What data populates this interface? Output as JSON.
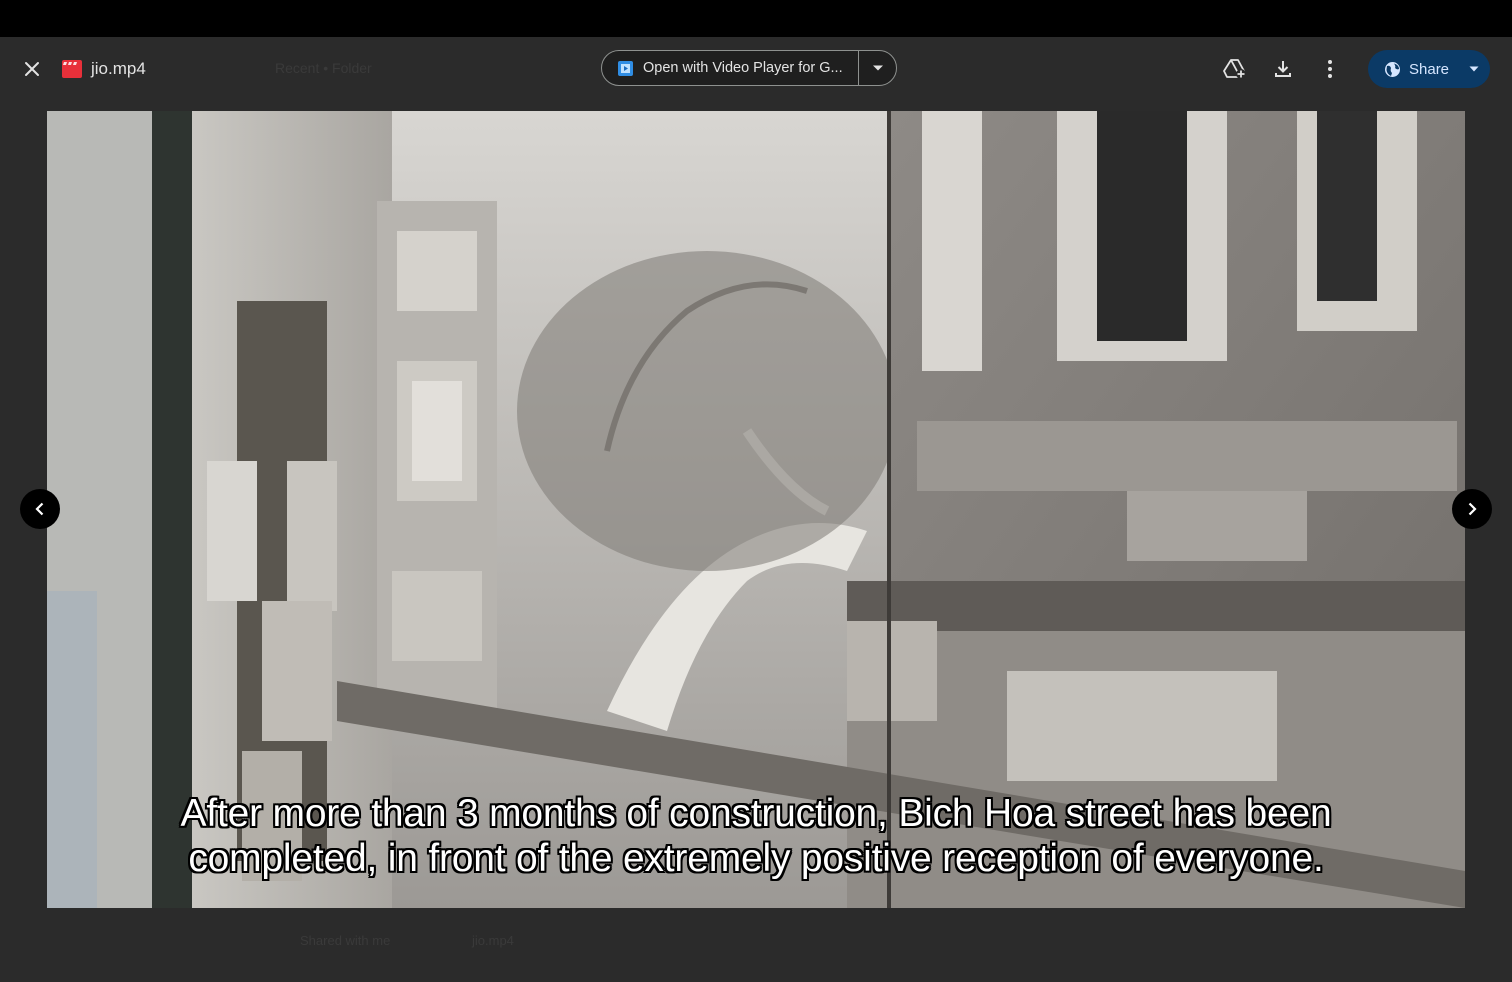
{
  "header": {
    "file_name": "jio.mp4",
    "open_with_label": "Open with Video Player for G...",
    "share_label": "Share"
  },
  "background_ghost": {
    "location_text": "Recent • Folder",
    "footer_left": "Shared with me",
    "footer_right": "jio.mp4"
  },
  "video": {
    "subtitle_line1": "After more than 3 months of construction, Bich Hoa street has been",
    "subtitle_line2": "completed, in front of the extremely positive reception of everyone."
  },
  "colors": {
    "viewer_bg": "#2b2b2b",
    "share_bg": "#0b3a66",
    "file_icon": "#e8303a",
    "app_icon": "#2f8de4"
  }
}
